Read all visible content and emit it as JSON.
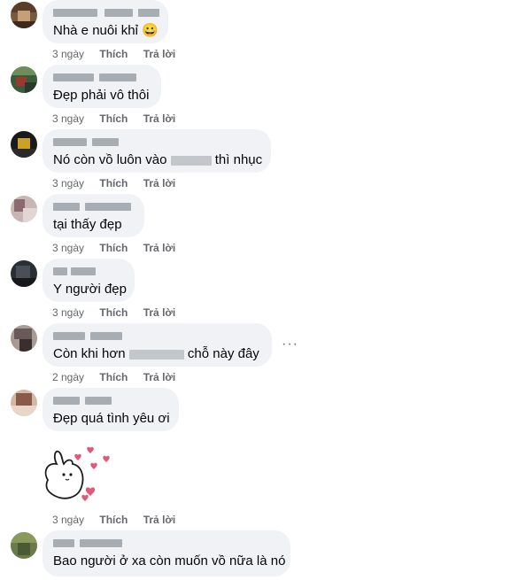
{
  "comments": [
    {
      "text": "Nhà e nuôi khỉ",
      "emoji": "😀",
      "time": "3 ngày",
      "like": "Thích",
      "reply": "Trả lời"
    },
    {
      "text": "Đẹp phải vô thôi",
      "time": "3 ngày",
      "like": "Thích",
      "reply": "Trả lời"
    },
    {
      "text_before": "Nó còn vồ luôn vào",
      "text_after": "thì nhục",
      "time": "3 ngày",
      "like": "Thích",
      "reply": "Trả lời"
    },
    {
      "text": "tại thấy đẹp",
      "time": "3 ngày",
      "like": "Thích",
      "reply": "Trả lời"
    },
    {
      "text": "Y người đẹp",
      "time": "3 ngày",
      "like": "Thích",
      "reply": "Trả lời"
    },
    {
      "text_before": "Còn khi hơn",
      "text_after": "chỗ này đây",
      "time": "2 ngày",
      "like": "Thích",
      "reply": "Trả lời",
      "more": "···"
    },
    {
      "text": "Đẹp quá tình yêu ơi",
      "time": "3 ngày",
      "like": "Thích",
      "reply": "Trả lời",
      "sticker": "bunny-hearts-sticker"
    },
    {
      "text": "Bao người ở xa còn muốn vồ nữa là nó"
    }
  ],
  "colors": {
    "bubble": "#f0f2f5",
    "meta": "#65676b",
    "text": "#050505"
  }
}
